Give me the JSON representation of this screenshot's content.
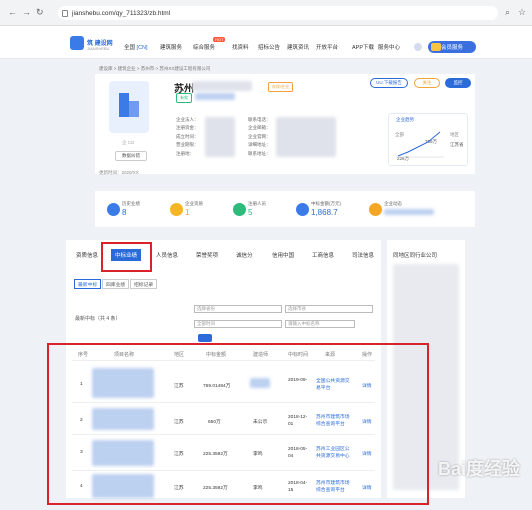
{
  "browser": {
    "url": "jianshebu.com/qy_711323/zb.html"
  },
  "header": {
    "logo_text": "筑 建设网",
    "logo_sub": "JIANSHEBU",
    "city_label": "全国",
    "city_code": "[CN]",
    "menu": [
      "建筑服务",
      "综合服务",
      "找资料",
      "招标公告",
      "建筑资讯",
      "开放平台",
      "APP下载",
      "服务中心"
    ],
    "hot_badge": "HOT",
    "vip_label": "会员服务"
  },
  "breadcrumb": "建设库 > 建筑企业 > 苏州市 > 苏州XX建设工程有限公司",
  "company": {
    "name": "苏州",
    "logo_caption": "企 CD",
    "data_button": "数据纠错",
    "updated": "更新时间：2020/XX",
    "tag_small": "有效",
    "tag_status": "存续/在业",
    "info_labels_left": [
      "企业法人：",
      "注册资金：",
      "成立时间：",
      "营业期限：",
      "注册地："
    ],
    "info_labels_right": [
      "联系电话：",
      "企业邮箱：",
      "企业官网：",
      "详细地址：",
      "联系地址："
    ],
    "buttons": [
      "UU 下载报告",
      "关注",
      "监控"
    ],
    "trend": {
      "title": "企业趋势",
      "lbl_a": "全部",
      "lbl_b": "地区",
      "val_a": "769万",
      "val_b": "226万",
      "region": "江苏省"
    }
  },
  "stats": [
    {
      "label": "历史业绩",
      "value": "8",
      "color": "#3b7be8"
    },
    {
      "label": "企业资质",
      "value": "1",
      "color": "#f5b623"
    },
    {
      "label": "注册人员",
      "value": "5",
      "color": "#2dbb7b"
    },
    {
      "label": "中标金额(万元)",
      "value": "1,868.7",
      "color": "#3b7be8"
    },
    {
      "label": "企业动态",
      "value": "",
      "color": "#f5a623"
    }
  ],
  "tabs": [
    "资质信息",
    "中标业绩",
    "人员信息",
    "荣誉奖项",
    "诚信分",
    "信用中国",
    "工商信息",
    "司法信息"
  ],
  "side_title": "同地区同行业公司",
  "subtabs": [
    "最新中标",
    "四库业绩",
    "招标记录"
  ],
  "filter": {
    "label": "最新中标（共 4 条）",
    "sel_region": "选择省份",
    "sel_city": "选择市县",
    "sel_time": "全部时间",
    "keyword": "请输入中标名称"
  },
  "table": {
    "headers": [
      "序号",
      "项目名称",
      "地区",
      "中标金额",
      "建造师",
      "中标时间",
      "来源",
      "操作"
    ],
    "rows": [
      {
        "idx": "1",
        "region": "江苏",
        "amount": "769.01484万",
        "builder": "",
        "date": "2019-09-",
        "source": "全国公共资源交易平台",
        "op": "详情"
      },
      {
        "idx": "2",
        "region": "江苏",
        "amount": "650万",
        "builder": "未公示",
        "date": "2018-12-01",
        "source": "苏州市建筑市场综合查询平台",
        "op": "详情"
      },
      {
        "idx": "3",
        "region": "江苏",
        "amount": "225.3592万",
        "builder": "李鸣",
        "date": "2018-05-04",
        "source": "苏州工业园区公共资源交易中心",
        "op": "详情"
      },
      {
        "idx": "4",
        "region": "江苏",
        "amount": "225.3592万",
        "builder": "李鸣",
        "date": "2018-04-15",
        "source": "苏州市建筑市场综合查询平台",
        "op": "详情"
      }
    ]
  },
  "watermark": "Bai度经验"
}
